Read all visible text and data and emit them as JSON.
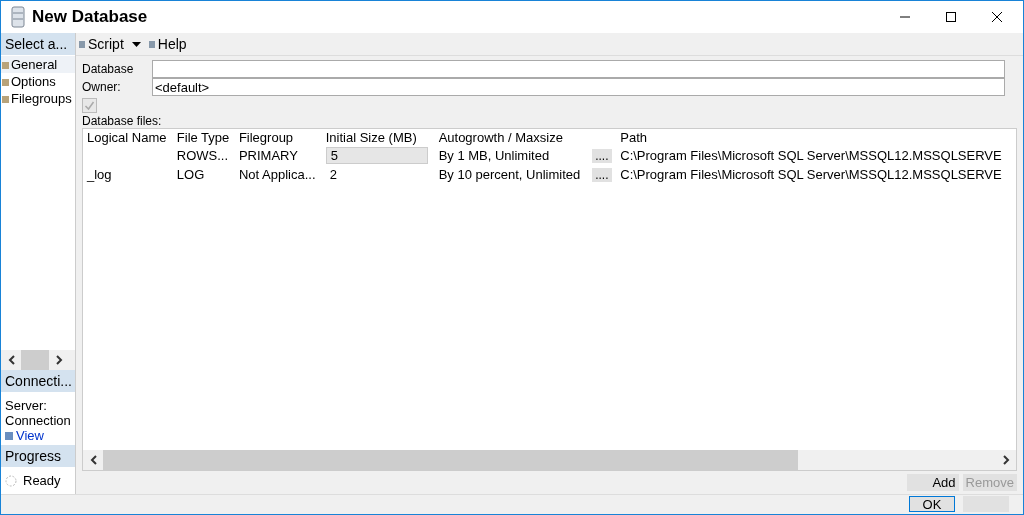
{
  "window": {
    "title": "New Database"
  },
  "sidebar": {
    "header": "Select a...",
    "pages": [
      {
        "label": "General",
        "selected": true
      },
      {
        "label": "Options",
        "selected": false
      },
      {
        "label": "Filegroups",
        "selected": false
      }
    ],
    "connection": {
      "header": "Connecti...",
      "lines": [
        "Server:",
        "Connection"
      ],
      "link": "View"
    },
    "progress": {
      "header": "Progress",
      "status": "Ready"
    }
  },
  "toolbar": [
    {
      "label": "Script",
      "dropdown": true
    },
    {
      "label": "Help",
      "dropdown": false
    }
  ],
  "form": {
    "database_label": "Database",
    "owner_label": "Owner:",
    "owner_value": "<default>",
    "fulltext": {
      "checked": true,
      "disabled": true
    },
    "files_label": "Database files:"
  },
  "table": {
    "columns": [
      "Logical Name",
      "File Type",
      "Filegroup",
      "Initial Size (MB)",
      "Autogrowth / Maxsize",
      "",
      "Path"
    ],
    "rows": [
      {
        "cells": [
          "",
          "ROWS...",
          "PRIMARY",
          "5",
          "By 1 MB, Unlimited",
          "....",
          "C:\\Program Files\\Microsoft SQL Server\\MSSQL12.MSSQLSERVE"
        ],
        "selected": true
      },
      {
        "cells": [
          "_log",
          "LOG",
          "Not Applica...",
          "2",
          "By 10 percent, Unlimited",
          "....",
          "C:\\Program Files\\Microsoft SQL Server\\MSSQL12.MSSQLSERVE"
        ],
        "selected": false
      }
    ]
  },
  "buttons": [
    {
      "label": "Add",
      "disabled": false
    },
    {
      "label": "Remove",
      "disabled": true
    }
  ],
  "footer": [
    {
      "label": "OK",
      "default": true
    }
  ]
}
